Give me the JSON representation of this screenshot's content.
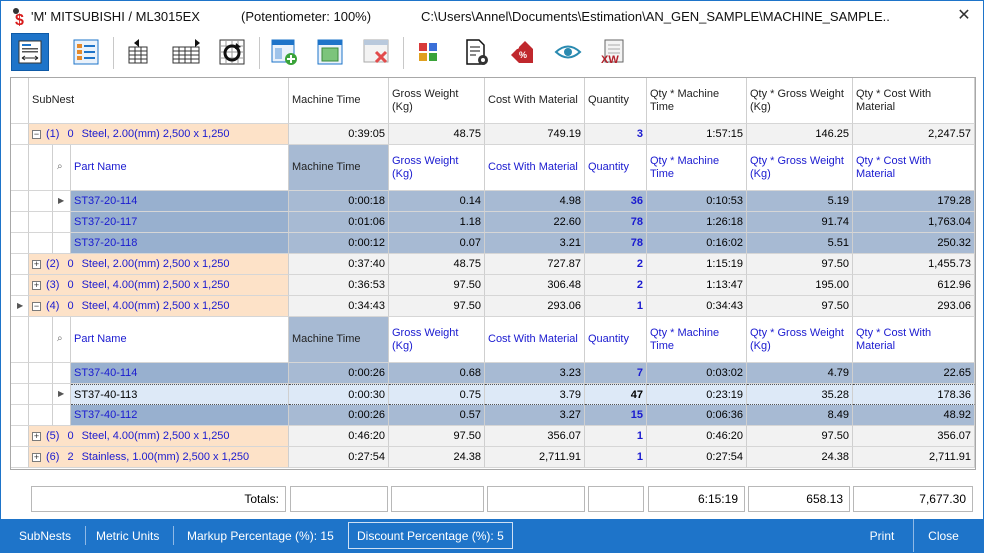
{
  "window": {
    "title_app": "'M'  MITSUBISHI / ML3015EX",
    "title_potentiometer": "(Potentiometer: 100%)",
    "title_path": "C:\\Users\\Annel\\Documents\\Estimation\\AN_GEN_SAMPLE\\MACHINE_SAMPLE...",
    "close_glyph": "✕"
  },
  "toolbar": {
    "buttons": [
      {
        "name": "subnest-view-icon"
      },
      {
        "name": "report-list-icon"
      },
      {
        "name": "previous-column-icon"
      },
      {
        "name": "next-column-icon"
      },
      {
        "name": "refresh-icon"
      },
      {
        "name": "add-layout-icon"
      },
      {
        "name": "layout-view-icon"
      },
      {
        "name": "remove-layout-icon"
      },
      {
        "name": "color-palette-icon"
      },
      {
        "name": "document-settings-icon"
      },
      {
        "name": "price-tag-icon"
      },
      {
        "name": "preview-eye-icon"
      },
      {
        "name": "export-excel-icon"
      }
    ]
  },
  "columns": {
    "subnest": "SubNest",
    "machine_time": "Machine Time",
    "gross_weight": "Gross Weight (Kg)",
    "cost_with_material": "Cost With Material",
    "quantity": "Quantity",
    "qty_machine_time": "Qty * Machine Time",
    "qty_gross_weight": "Qty * Gross Weight (Kg)",
    "qty_cost_with_material": "Qty * Cost With Material"
  },
  "detail_columns": {
    "part_name": "Part Name",
    "machine_time": "Machine Time",
    "gross_weight": "Gross Weight (Kg)",
    "cost_with_material": "Cost With Material",
    "quantity": "Quantity",
    "qty_machine_time": "Qty * Machine Time",
    "qty_gross_weight": "Qty * Gross Weight (Kg)",
    "qty_cost_with_material": "Qty * Cost With Material"
  },
  "subnests": [
    {
      "id": "(1)",
      "idx": "0",
      "desc": "Steel, 2.00(mm) 2,500 x 1,250",
      "expander": "−",
      "machine_time": "0:39:05",
      "gross_weight": "48.75",
      "cost": "749.19",
      "qty": "3",
      "qty_mt": "1:57:15",
      "qty_gw": "146.25",
      "qty_cost": "2,247.57",
      "parts": [
        {
          "name": "ST37-20-114",
          "machine_time": "0:00:18",
          "gross_weight": "0.14",
          "cost": "4.98",
          "qty": "36",
          "qty_mt": "0:10:53",
          "qty_gw": "5.19",
          "qty_cost": "179.28"
        },
        {
          "name": "ST37-20-117",
          "machine_time": "0:01:06",
          "gross_weight": "1.18",
          "cost": "22.60",
          "qty": "78",
          "qty_mt": "1:26:18",
          "qty_gw": "91.74",
          "qty_cost": "1,763.04"
        },
        {
          "name": "ST37-20-118",
          "machine_time": "0:00:12",
          "gross_weight": "0.07",
          "cost": "3.21",
          "qty": "78",
          "qty_mt": "0:16:02",
          "qty_gw": "5.51",
          "qty_cost": "250.32"
        }
      ]
    },
    {
      "id": "(2)",
      "idx": "0",
      "desc": "Steel, 2.00(mm) 2,500 x 1,250",
      "expander": "+",
      "machine_time": "0:37:40",
      "gross_weight": "48.75",
      "cost": "727.87",
      "qty": "2",
      "qty_mt": "1:15:19",
      "qty_gw": "97.50",
      "qty_cost": "1,455.73"
    },
    {
      "id": "(3)",
      "idx": "0",
      "desc": "Steel, 4.00(mm) 2,500 x 1,250",
      "expander": "+",
      "machine_time": "0:36:53",
      "gross_weight": "97.50",
      "cost": "306.48",
      "qty": "2",
      "qty_mt": "1:13:47",
      "qty_gw": "195.00",
      "qty_cost": "612.96"
    },
    {
      "id": "(4)",
      "idx": "0",
      "desc": "Steel, 4.00(mm) 2,500 x 1,250",
      "expander": "−",
      "machine_time": "0:34:43",
      "gross_weight": "97.50",
      "cost": "293.06",
      "qty": "1",
      "qty_mt": "0:34:43",
      "qty_gw": "97.50",
      "qty_cost": "293.06",
      "parts": [
        {
          "name": "ST37-40-114",
          "machine_time": "0:00:26",
          "gross_weight": "0.68",
          "cost": "3.23",
          "qty": "7",
          "qty_mt": "0:03:02",
          "qty_gw": "4.79",
          "qty_cost": "22.65"
        },
        {
          "name": "ST37-40-113",
          "machine_time": "0:00:30",
          "gross_weight": "0.75",
          "cost": "3.79",
          "qty": "47",
          "qty_mt": "0:23:19",
          "qty_gw": "35.28",
          "qty_cost": "178.36"
        },
        {
          "name": "ST37-40-112",
          "machine_time": "0:00:26",
          "gross_weight": "0.57",
          "cost": "3.27",
          "qty": "15",
          "qty_mt": "0:06:36",
          "qty_gw": "8.49",
          "qty_cost": "48.92"
        }
      ]
    },
    {
      "id": "(5)",
      "idx": "0",
      "desc": "Steel, 4.00(mm) 2,500 x 1,250",
      "expander": "+",
      "machine_time": "0:46:20",
      "gross_weight": "97.50",
      "cost": "356.07",
      "qty": "1",
      "qty_mt": "0:46:20",
      "qty_gw": "97.50",
      "qty_cost": "356.07"
    },
    {
      "id": "(6)",
      "idx": "2",
      "desc": "Stainless, 1.00(mm) 2,500 x 1,250",
      "expander": "+",
      "machine_time": "0:27:54",
      "gross_weight": "24.38",
      "cost": "2,711.91",
      "qty": "1",
      "qty_mt": "0:27:54",
      "qty_gw": "24.38",
      "qty_cost": "2,711.91"
    }
  ],
  "totals": {
    "label": "Totals:",
    "machine_time": "",
    "gross_weight": "",
    "cost": "",
    "qty": "",
    "qty_mt": "6:15:19",
    "qty_gw": "658.13",
    "qty_cost": "7,677.30"
  },
  "statusbar": {
    "subnests": "SubNests",
    "units": "Metric Units",
    "markup": "Markup Percentage (%): 15",
    "discount": "Discount Percentage (%): 5",
    "print": "Print",
    "close": "Close"
  },
  "colors": {
    "accent": "#1e74c9",
    "subnest_row": "#fde2c8",
    "selected_row": "#a7bad3",
    "link_text": "#1a1ad0"
  }
}
